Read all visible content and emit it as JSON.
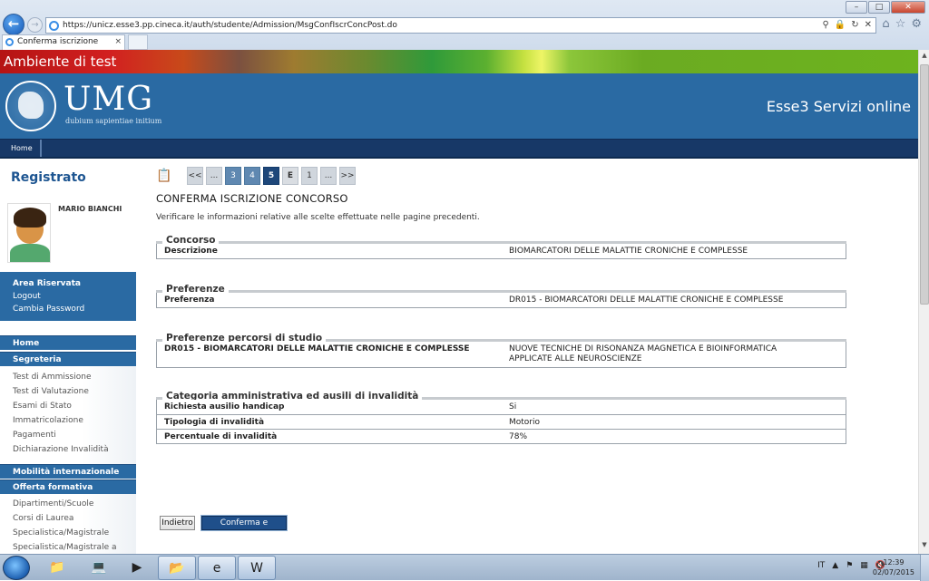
{
  "browser": {
    "url": "https://unicz.esse3.pp.cineca.it/auth/studente/Admission/MsgConfIscrConcPost.do",
    "tab_title": "Conferma iscrizione conco...",
    "window_buttons": [
      "–",
      "□",
      "✕"
    ]
  },
  "site": {
    "test_banner": "Ambiente di test",
    "logo_text": "UMG",
    "logo_motto": "dubium sapientiae initium",
    "service_name": "Esse3 Servizi online",
    "topnav_home": "Home"
  },
  "sidebar": {
    "title": "Registrato",
    "user_name": "MARIO BIANCHI",
    "area": {
      "title": "Area Riservata",
      "logout": "Logout",
      "change_password": "Cambia Password"
    },
    "home": "Home",
    "segreteria": {
      "title": "Segreteria",
      "items": [
        "Test di Ammissione",
        "Test di Valutazione",
        "Esami di Stato",
        "Immatricolazione",
        "Pagamenti",
        "Dichiarazione Invalidità"
      ]
    },
    "mobilita": "Mobilità internazionale",
    "offerta": {
      "title": "Offerta formativa",
      "items": [
        "Dipartimenti/Scuole",
        "Corsi di Laurea",
        "Specialistica/Magistrale",
        "Specialistica/Magistrale a"
      ]
    }
  },
  "pager": {
    "icon": "page-icon",
    "items": [
      {
        "label": "<<",
        "state": "nav"
      },
      {
        "label": "...",
        "state": "nav"
      },
      {
        "label": "3",
        "state": "done"
      },
      {
        "label": "4",
        "state": "done"
      },
      {
        "label": "5",
        "state": "current"
      },
      {
        "label": "E",
        "state": "e"
      },
      {
        "label": "1",
        "state": "nav"
      },
      {
        "label": "...",
        "state": "nav"
      },
      {
        "label": ">>",
        "state": "nav"
      }
    ]
  },
  "main": {
    "title": "CONFERMA ISCRIZIONE CONCORSO",
    "intro": "Verificare le informazioni relative alle scelte effettuate nelle pagine precedenti.",
    "concorso": {
      "legend": "Concorso",
      "label": "Descrizione",
      "value": "BIOMARCATORI DELLE MALATTIE CRONICHE E COMPLESSE"
    },
    "preferenze": {
      "legend": "Preferenze",
      "label": "Preferenza",
      "value": "DR015 - BIOMARCATORI DELLE MALATTIE CRONICHE E COMPLESSE"
    },
    "percorsi": {
      "legend": "Preferenze percorsi di studio",
      "label": "DR015 - BIOMARCATORI DELLE MALATTIE CRONICHE E COMPLESSE",
      "value": "NUOVE TECNICHE DI RISONANZA MAGNETICA E BIOINFORMATICA APPLICATE ALLE NEUROSCIENZE"
    },
    "categoria": {
      "legend": "Categoria amministrativa ed ausili di invalidità",
      "rows": [
        {
          "label": "Richiesta ausilio handicap",
          "value": "Si"
        },
        {
          "label": "Tipologia di invalidità",
          "value": "Motorio"
        },
        {
          "label": "Percentuale di invalidità",
          "value": "78%"
        }
      ]
    },
    "buttons": {
      "back": "Indietro",
      "confirm": "Conferma e prosegui"
    }
  },
  "taskbar": {
    "language": "IT",
    "time": "12:39",
    "date": "02/07/2015"
  }
}
